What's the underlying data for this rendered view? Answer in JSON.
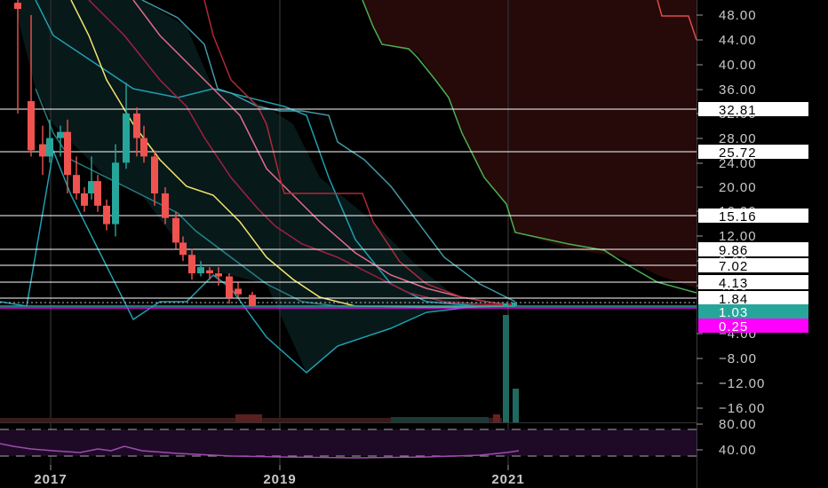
{
  "chart_data": {
    "type": "candlestick",
    "price_axis": {
      "range": [
        -18,
        50
      ],
      "ticks": [
        "48.00",
        "44.00",
        "40.00",
        "36.00",
        "32.00",
        "28.00",
        "24.00",
        "20.00",
        "16.00",
        "12.00",
        "8.00",
        "4.00",
        "−4.00",
        "−8.00",
        "−12.00",
        "−16.00"
      ]
    },
    "time_axis": {
      "ticks": [
        "2017",
        "2019",
        "2021"
      ]
    },
    "rsi_pane": {
      "ticks": [
        "80.00",
        "40.00"
      ],
      "levels": [
        70,
        30
      ]
    },
    "price_levels": [
      {
        "label": "32.81",
        "value": 32.81,
        "style": "white"
      },
      {
        "label": "25.72",
        "value": 25.72,
        "style": "white"
      },
      {
        "label": "15.16",
        "value": 15.16,
        "style": "white"
      },
      {
        "label": "9.86",
        "value": 9.86,
        "style": "white"
      },
      {
        "label": "7.02",
        "value": 7.02,
        "style": "white"
      },
      {
        "label": "4.13",
        "value": 4.13,
        "style": "white"
      },
      {
        "label": "1.84",
        "value": 1.84,
        "style": "white"
      },
      {
        "label": "1.03",
        "value": 1.03,
        "style": "teal"
      },
      {
        "label": "0.25",
        "value": 0.25,
        "style": "magenta"
      }
    ],
    "candles": [
      [
        20,
        50,
        49,
        53,
        32
      ],
      [
        35,
        34,
        26,
        48,
        25
      ],
      [
        48,
        27,
        25,
        30,
        22
      ],
      [
        56,
        25,
        28,
        31,
        24
      ],
      [
        68,
        28,
        29,
        30,
        25
      ],
      [
        76,
        29,
        22,
        31,
        19
      ],
      [
        86,
        22,
        19,
        25,
        18
      ],
      [
        95,
        19,
        17,
        20,
        16
      ],
      [
        103,
        19,
        21,
        25,
        18
      ],
      [
        110,
        21,
        17,
        22,
        16
      ],
      [
        120,
        17,
        14,
        18,
        13
      ],
      [
        130,
        14,
        24,
        27,
        12
      ],
      [
        142,
        24,
        32,
        37,
        23
      ],
      [
        154,
        32,
        28,
        33,
        25
      ],
      [
        162,
        28,
        25,
        30,
        24
      ],
      [
        174,
        25,
        19,
        26,
        17
      ],
      [
        186,
        19,
        15,
        20,
        14
      ],
      [
        198,
        15,
        11,
        16,
        10
      ],
      [
        206,
        11,
        9,
        12,
        8
      ],
      [
        216,
        9,
        6,
        10,
        5
      ],
      [
        226,
        6,
        7,
        8,
        5.5
      ],
      [
        236,
        6.5,
        6,
        7,
        5
      ],
      [
        246,
        6,
        5.5,
        7,
        4
      ],
      [
        258,
        5.5,
        2,
        6,
        1.5
      ],
      [
        268,
        3.5,
        2.6,
        4.5,
        2
      ],
      [
        284,
        2.5,
        0.5,
        3,
        0.2
      ]
    ],
    "colors": {
      "up": "#26a69a",
      "down": "#ef5350",
      "teal_label": "#26a69a",
      "magenta_label": "#ff00ff",
      "background": "#000000",
      "cloud": "#3a0f0f"
    }
  }
}
